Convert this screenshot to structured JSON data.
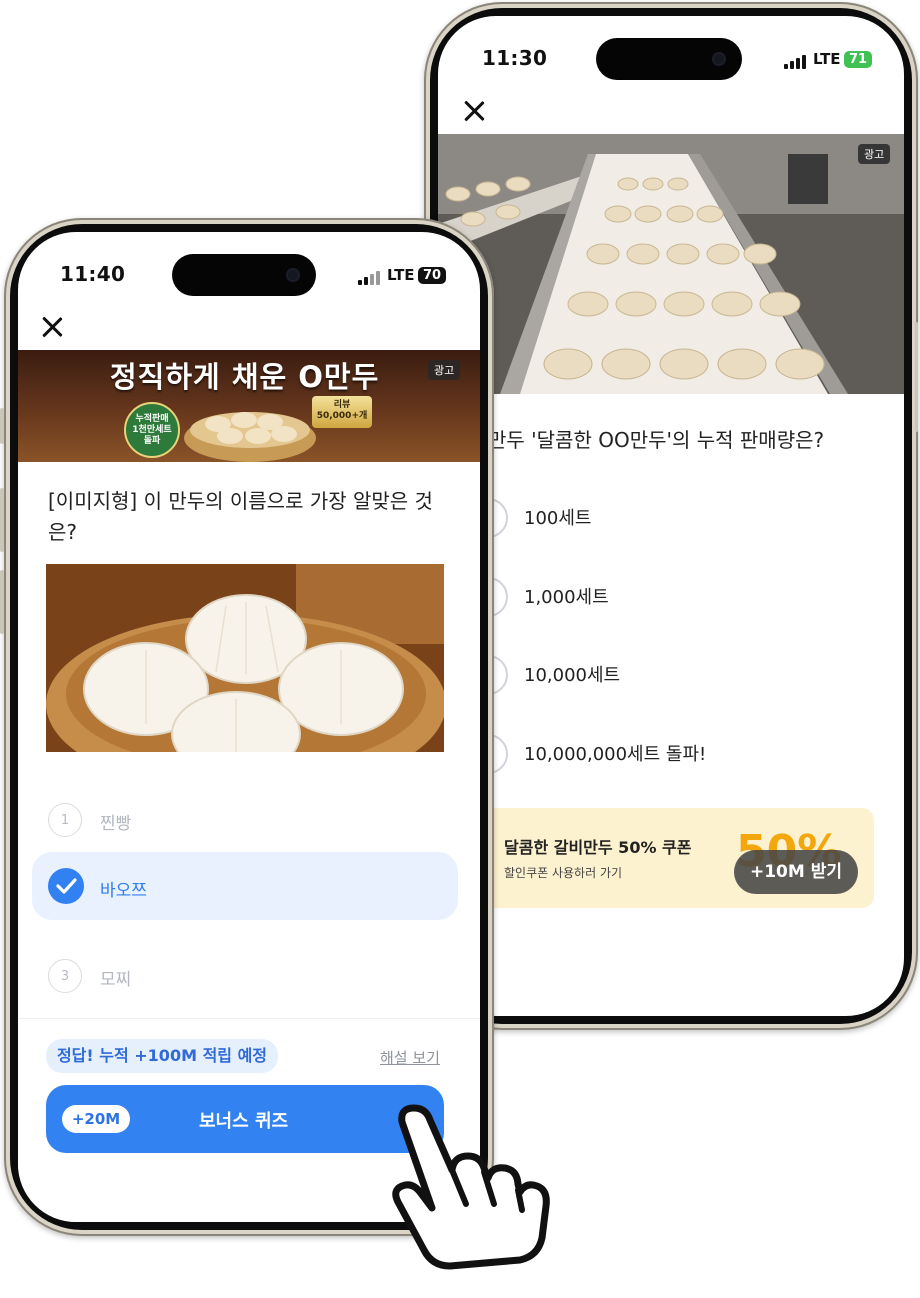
{
  "back_phone": {
    "status": {
      "time": "11:30",
      "network": "LTE",
      "battery": "71"
    },
    "ad_label": "광고",
    "question": "만두 '달콤한 OO만두'의 누적 판매량은?",
    "options": [
      {
        "label": "100세트"
      },
      {
        "label": "1,000세트"
      },
      {
        "label": "10,000세트"
      },
      {
        "label": "10,000,000세트 돌파!"
      }
    ],
    "coupon": {
      "title": "달콤한 갈비만두 50% 쿠폰",
      "subtitle": "할인쿠폰 사용하러 가기",
      "percent": "50%",
      "button": "+10M 받기"
    }
  },
  "front_phone": {
    "status": {
      "time": "11:40",
      "network": "LTE",
      "battery": "70"
    },
    "ad_banner": {
      "title": "정직하게 채운 O만두",
      "ad_label": "광고",
      "badge_green": [
        "누적판매",
        "1천만세트",
        "돌파"
      ],
      "badge_gold": [
        "리뷰",
        "50,000+개"
      ]
    },
    "question": "[이미지형] 이 만두의 이름으로 가장 알맞은 것은?",
    "options": [
      {
        "num": "1",
        "label": "찐빵",
        "selected": false
      },
      {
        "num": "",
        "label": "바오쯔",
        "selected": true
      },
      {
        "num": "3",
        "label": "모찌",
        "selected": false
      }
    ],
    "result_pill": "정답! 누적 +100M 적립 예정",
    "explain_link": "해설 보기",
    "cta": {
      "badge": "+20M",
      "label": "보너스 퀴즈"
    }
  },
  "colors": {
    "accent": "#3283f1",
    "selected_bg": "#e8f1fd",
    "coupon_bg": "#fdf2cf",
    "battery_green": "#3fc153"
  }
}
